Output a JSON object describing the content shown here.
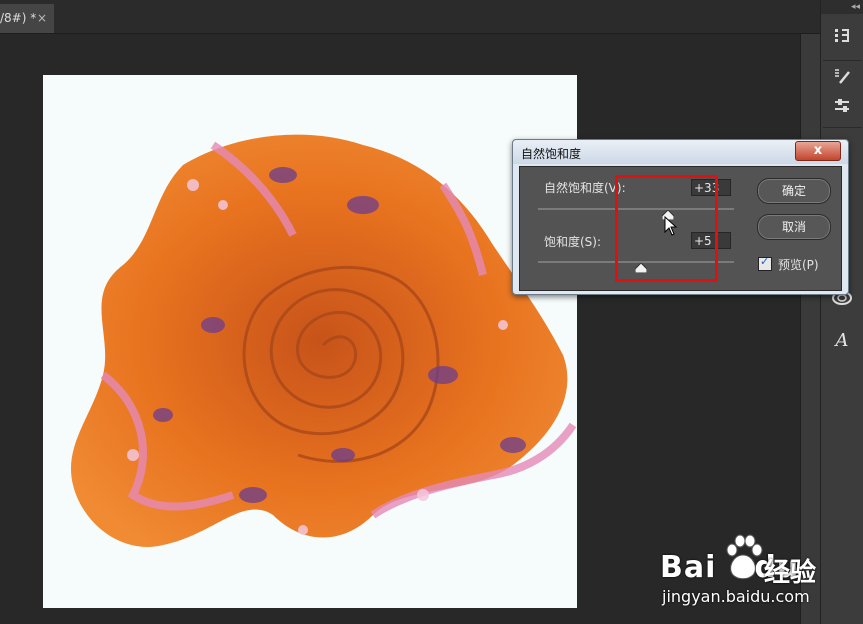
{
  "document_tab": {
    "title": "/8#) *",
    "close": "×"
  },
  "panel": {
    "collapse": "◂◂",
    "icons": [
      "histogram-icon",
      "brush-presets-icon",
      "adjustments-icon",
      "creative-cloud-libraries-icon",
      "character-icon"
    ]
  },
  "dialog": {
    "title": "自然饱和度",
    "close": "x",
    "vibrance_label": "自然饱和度(V):",
    "vibrance_value": "+33",
    "vibrance_level": 33,
    "saturation_label": "饱和度(S):",
    "saturation_value": "+5",
    "saturation_level": 5,
    "ok_label": "确定",
    "cancel_label": "取消",
    "preview_label": "预览(P)",
    "preview_checked": true
  },
  "watermark": {
    "brand": "Bai",
    "brand2": "du",
    "cn": "经验",
    "url": "jingyan.baidu.com"
  },
  "colors": {
    "highlight": "#e01010",
    "scarf": "#e8731f",
    "canvas": "#f6fbfb"
  }
}
